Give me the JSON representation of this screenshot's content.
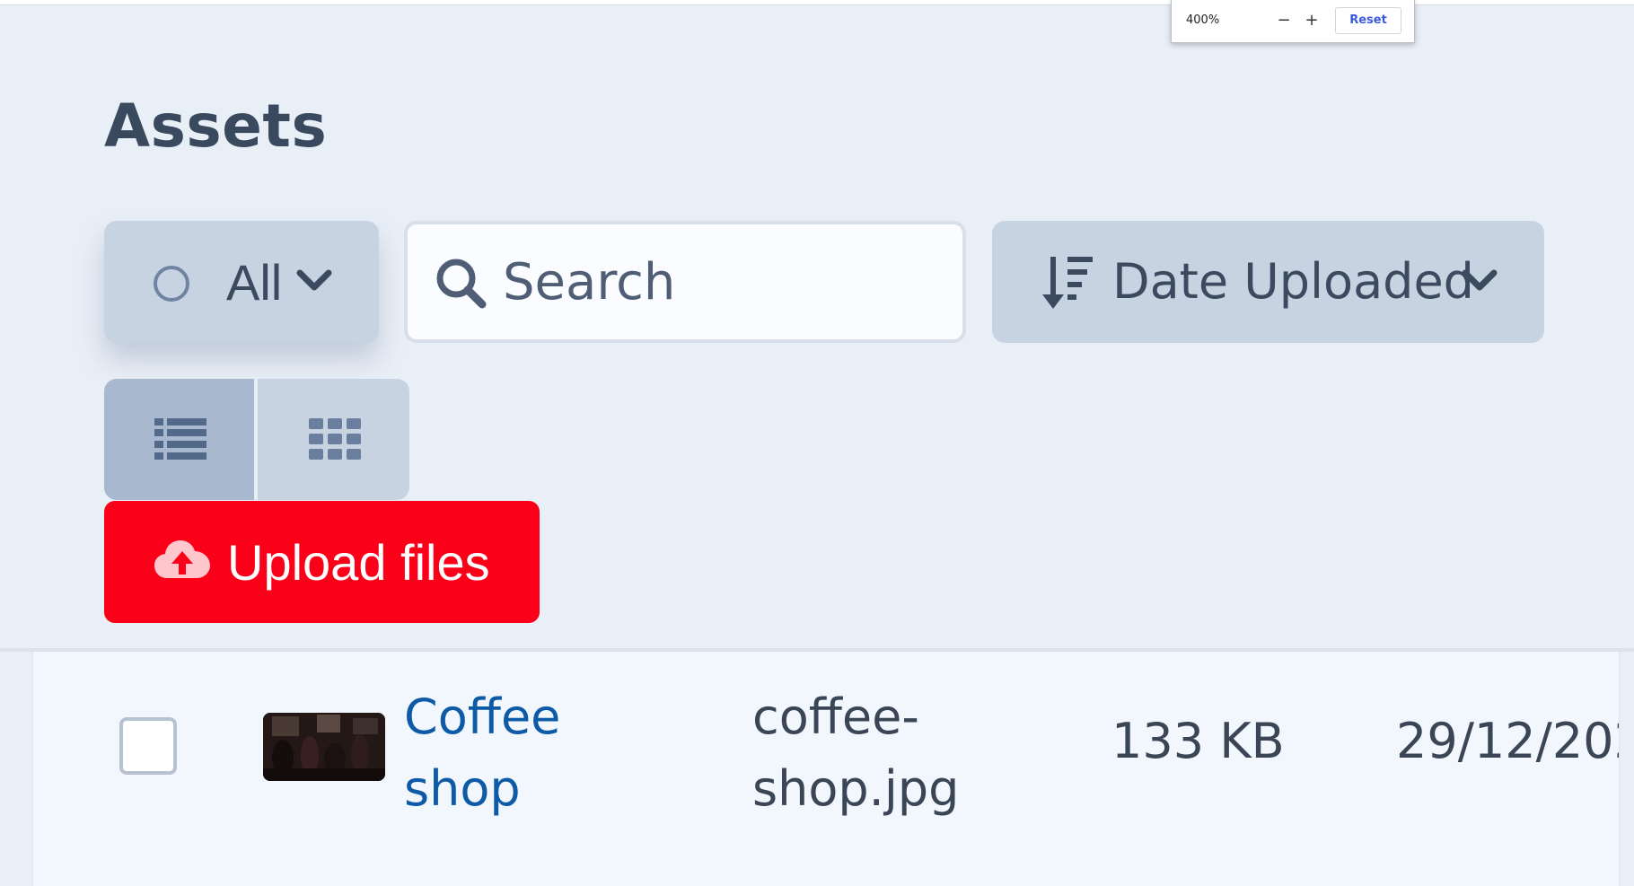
{
  "zoom": {
    "level": "400%",
    "decrease_label": "−",
    "increase_label": "+",
    "reset_label": "Reset"
  },
  "page": {
    "title": "Assets"
  },
  "toolbar": {
    "filter_label": "All",
    "search_placeholder": "Search",
    "sort_label": "Date Uploaded",
    "upload_label": "Upload files"
  },
  "icons": {
    "filter": "radio-circle-icon",
    "search": "search-icon",
    "sort": "sort-descending-icon",
    "list_view": "list-icon",
    "grid_view": "grid-icon",
    "upload": "cloud-upload-icon",
    "dropdown": "chevron-down-icon"
  },
  "colors": {
    "upload_button": "#fa0019",
    "link": "#0d5aa7",
    "toolbar_button": "#c8d3e2",
    "active_view": "#a8b8cf"
  },
  "assets": [
    {
      "name": "Coffee shop",
      "filename": "coffee-shop.jpg",
      "size": "133 KB",
      "date": "29/12/202"
    }
  ]
}
